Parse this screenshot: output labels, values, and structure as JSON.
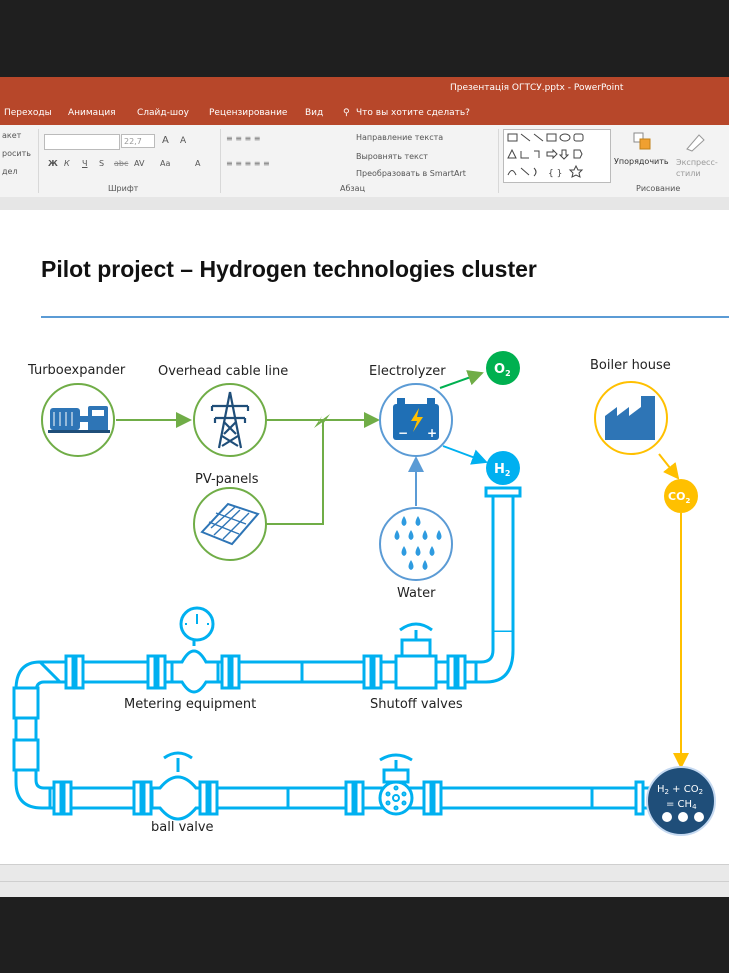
{
  "window": {
    "title": "Презентація ОГТСУ.pptx - PowerPoint"
  },
  "menu": {
    "items": [
      "Переходы",
      "Анимация",
      "Слайд-шоу",
      "Рецензирование",
      "Вид"
    ],
    "tell_me": "Что вы хотите сделать?"
  },
  "ribbon": {
    "left_items": [
      "акет",
      "росить",
      "дел"
    ],
    "font_size": "22,7",
    "font_group_label": "Шрифт",
    "paragraph_group_label": "Абзац",
    "drawing_group_label": "Рисование",
    "text_direction": "Направление текста",
    "align_text": "Выровнять текст",
    "smartart": "Преобразовать в SmartArt",
    "arrange": "Упорядочить",
    "quick_styles": "Экспресс-стили",
    "font_buttons": [
      "Ж",
      "К",
      "Ч",
      "S",
      "abc",
      "AV",
      "Aa",
      "A"
    ]
  },
  "slide": {
    "title": "Pilot project – Hydrogen technologies cluster",
    "labels": {
      "turboexpander": "Turboexpander",
      "overhead": "Overhead cable line",
      "electrolyzer": "Electrolyzer",
      "boiler": "Boiler house",
      "pv": "PV-panels",
      "water": "Water",
      "metering": "Metering equipment",
      "shutoff": "Shutoff valves",
      "ballvalve": "ball valve"
    },
    "badges": {
      "o2": "O",
      "o2_sub": "2",
      "h2": "H",
      "h2_sub": "2",
      "co2": "CO",
      "co2_sub": "2"
    },
    "reactor": {
      "line1_a": "H",
      "line1_a_sub": "2",
      "line1_b": " + CO",
      "line1_b_sub": "2",
      "line2_a": "= CH",
      "line2_a_sub": "4"
    }
  },
  "colors": {
    "titlebar": "#b7472a",
    "green": "#70ad47",
    "blue": "#0070c0",
    "pipe": "#00b0f0",
    "o2_badge": "#00b050",
    "co2_badge": "#ffc000",
    "reactor": "#1f4e79",
    "rule": "#5b9bd5"
  },
  "icons": [
    "turbine-icon",
    "pylon-icon",
    "battery-icon",
    "factory-icon",
    "solar-panel-icon",
    "water-drops-icon",
    "lightning-icon",
    "gauge-icon",
    "valve-icon"
  ]
}
